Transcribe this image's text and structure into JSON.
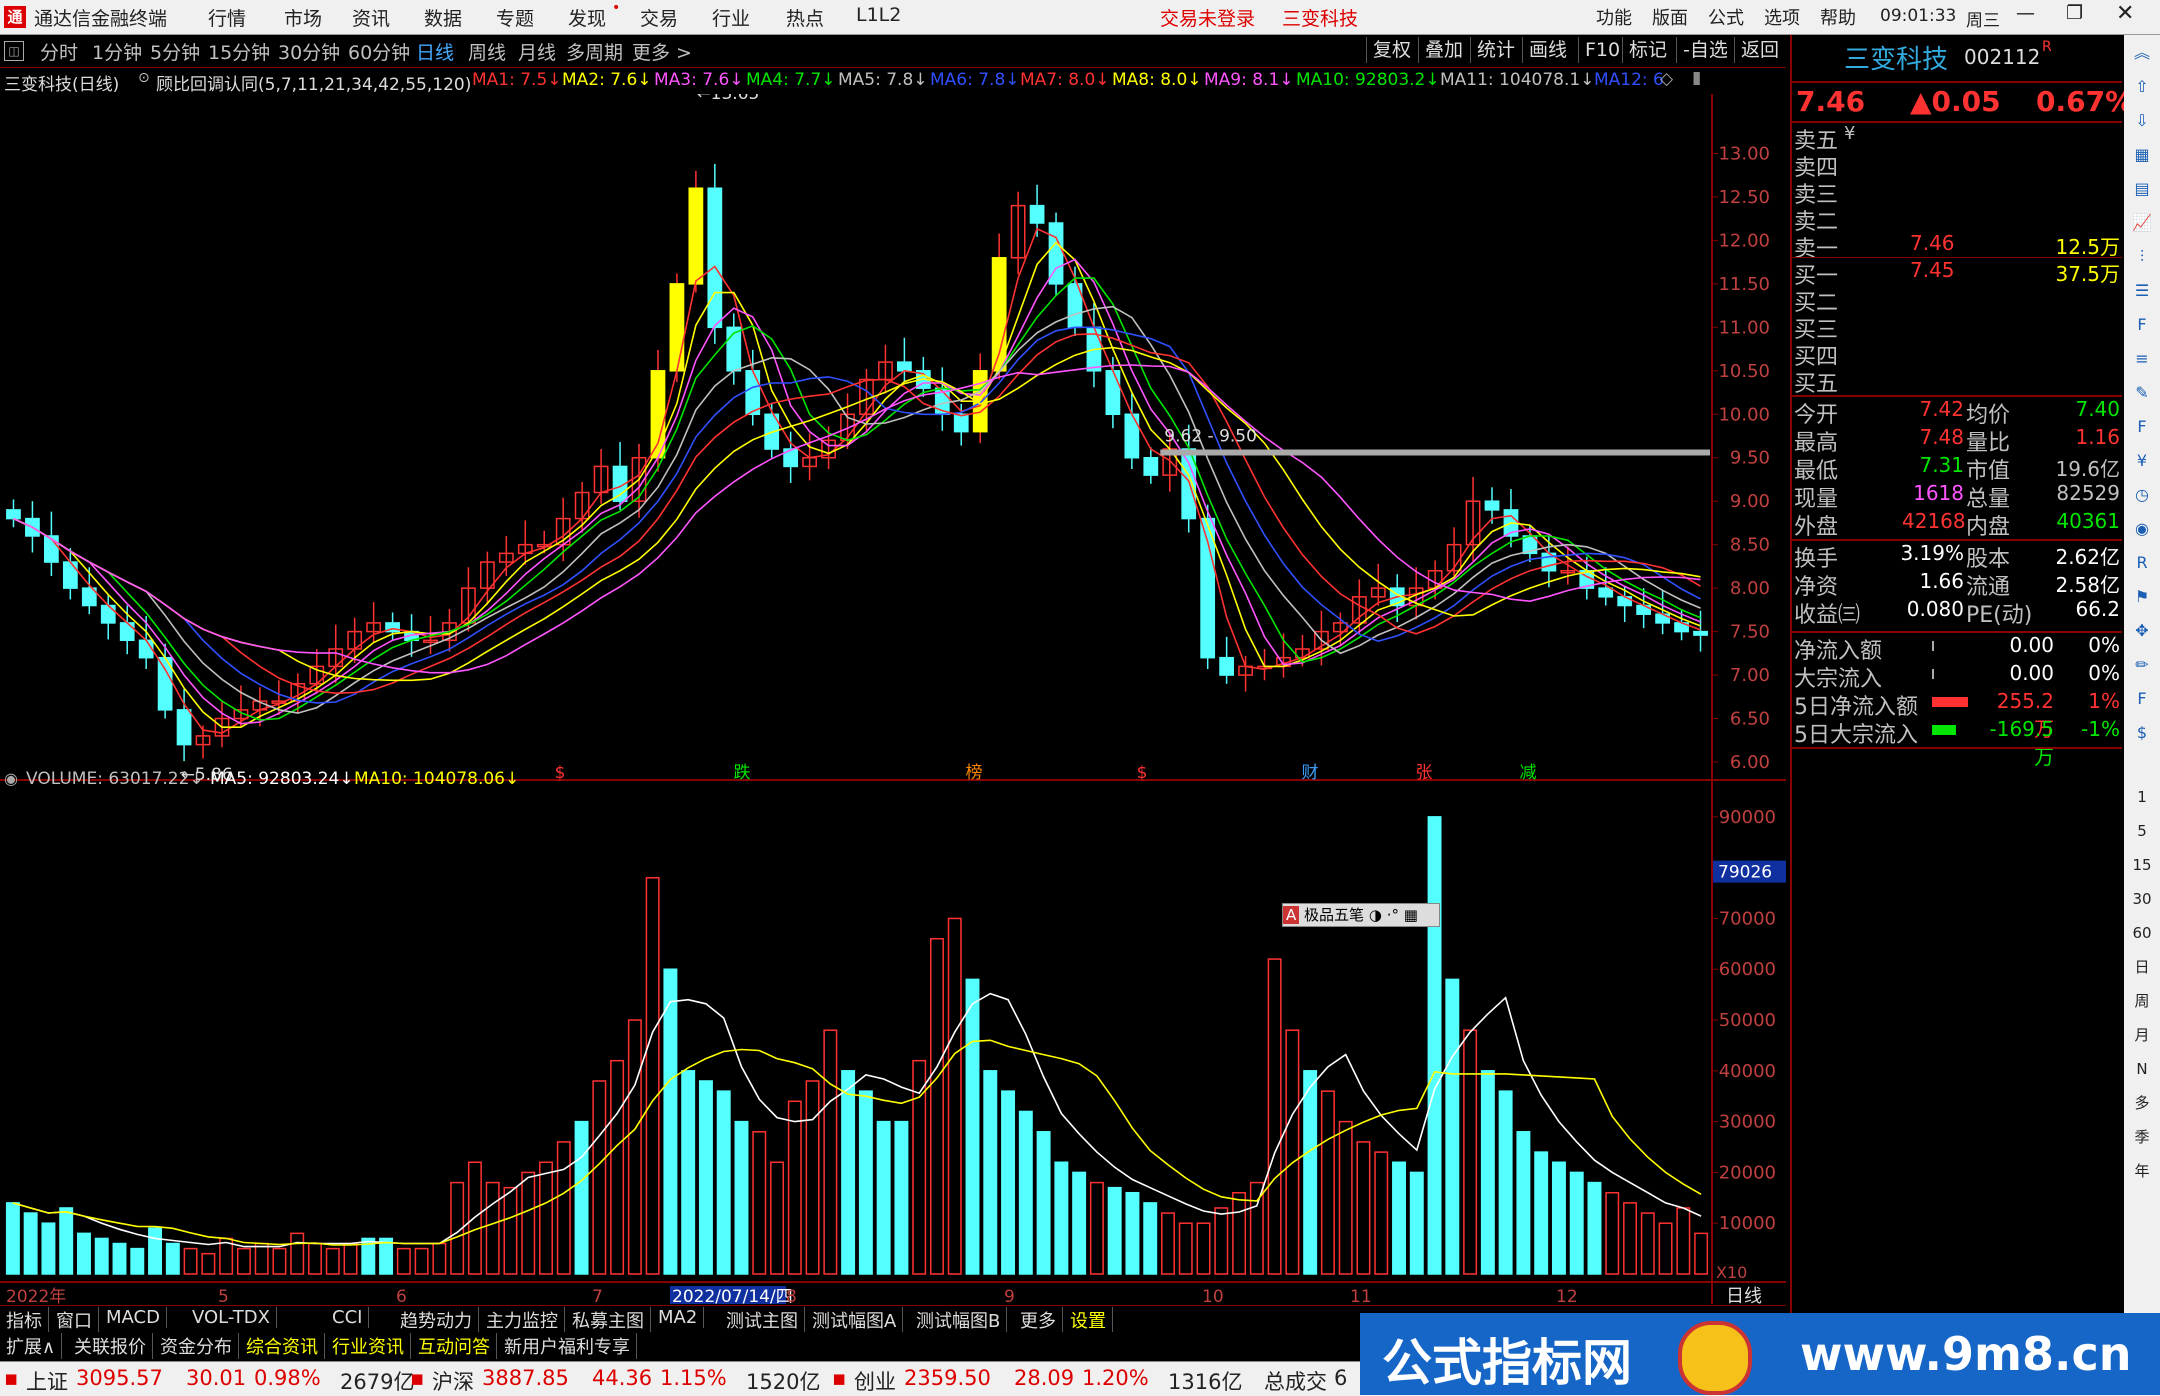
{
  "menubar": {
    "app_title": "通达信金融终端",
    "items": [
      "行情",
      "市场",
      "资讯",
      "数据",
      "专题",
      "发现",
      "交易",
      "行业",
      "热点",
      "L1L2"
    ],
    "status_left": "交易未登录",
    "status_right": "三变科技",
    "right_items": [
      "功能",
      "版面",
      "公式",
      "选项",
      "帮助"
    ],
    "clock": "09:01:33",
    "weekday": "周三"
  },
  "periods": {
    "items": [
      "分时",
      "1分钟",
      "5分钟",
      "15分钟",
      "30分钟",
      "60分钟",
      "日线",
      "周线",
      "月线",
      "多周期",
      "更多 >"
    ],
    "active": "日线",
    "right_buttons": [
      "复权",
      "叠加",
      "统计",
      "画线",
      "F10",
      "标记",
      "-自选",
      "返回"
    ]
  },
  "indicator_header": {
    "stock": "三变科技(日线)",
    "formula": "顾比回调认同(5,7,11,21,34,42,55,120)",
    "mas": [
      {
        "label": "MA1: 7.5↓",
        "color": "#ff3232"
      },
      {
        "label": "MA2: 7.6↓",
        "color": "#ffff00"
      },
      {
        "label": "MA3: 7.6↓",
        "color": "#ff55ff"
      },
      {
        "label": "MA4: 7.7↓",
        "color": "#00e600"
      },
      {
        "label": "MA5: 7.8↓",
        "color": "#c0c0c0"
      },
      {
        "label": "MA6: 7.8↓",
        "color": "#3050ff"
      },
      {
        "label": "MA7: 8.0↓",
        "color": "#ff3232"
      },
      {
        "label": "MA8: 8.0↓",
        "color": "#ffff00"
      },
      {
        "label": "MA9: 8.1↓",
        "color": "#ff55ff"
      },
      {
        "label": "MA10: 92803.2↓",
        "color": "#00e600"
      },
      {
        "label": "MA11: 104078.1↓",
        "color": "#c0c0c0"
      },
      {
        "label": "MA12: 6",
        "color": "#3050ff"
      }
    ]
  },
  "chart_data": [
    {
      "type": "candlestick",
      "title": "三变科技(日线)",
      "y_ticks": [
        "13.00",
        "12.50",
        "12.00",
        "11.50",
        "11.00",
        "10.50",
        "10.00",
        "9.50",
        "9.00",
        "8.50",
        "8.00",
        "7.50",
        "7.00",
        "6.50",
        "6.00"
      ],
      "ylim": [
        6.0,
        13.5
      ],
      "annotations": [
        "13.65",
        "5.86",
        "9.62 - 9.50"
      ],
      "events": [
        "$",
        "跌",
        "榜",
        "$",
        "财",
        "张",
        "减"
      ],
      "close_series_approx": [
        8.8,
        8.6,
        8.3,
        8.0,
        7.8,
        7.6,
        7.4,
        7.2,
        6.6,
        6.2,
        6.3,
        6.5,
        6.6,
        6.7,
        6.7,
        6.9,
        7.1,
        7.3,
        7.5,
        7.6,
        7.5,
        7.4,
        7.4,
        7.6,
        8.0,
        8.3,
        8.4,
        8.5,
        8.5,
        8.8,
        9.1,
        9.4,
        9.0,
        9.5,
        10.5,
        11.5,
        12.6,
        11.0,
        10.5,
        10.0,
        9.6,
        9.4,
        9.5,
        9.7,
        10.0,
        10.4,
        10.6,
        10.5,
        10.3,
        10.0,
        9.8,
        10.5,
        11.8,
        12.4,
        12.2,
        11.5,
        11.0,
        10.5,
        10.0,
        9.5,
        9.3,
        9.6,
        8.8,
        7.2,
        7.0,
        7.1,
        7.1,
        7.2,
        7.3,
        7.5,
        7.6,
        7.9,
        8.0,
        7.8,
        8.0,
        8.2,
        8.5,
        9.0,
        8.9,
        8.6,
        8.4,
        8.2,
        8.2,
        8.0,
        7.9,
        7.8,
        7.7,
        7.6,
        7.5,
        7.46
      ]
    },
    {
      "type": "bar",
      "title": "VOLUME",
      "series_labels": [
        {
          "label": "VOLUME: 63017.22↓",
          "color": "#c0c0c0"
        },
        {
          "label": "MA5: 92803.24↓",
          "color": "#ffffff"
        },
        {
          "label": "MA10: 104078.06↓",
          "color": "#ffff00"
        }
      ],
      "y_ticks": [
        "90000",
        "80000",
        "70000",
        "60000",
        "50000",
        "40000",
        "30000",
        "20000",
        "10000"
      ],
      "ylim": [
        0,
        90000
      ],
      "current_marker": "79026",
      "multiplier_label": "X10",
      "values_approx": [
        14,
        12,
        10,
        13,
        8,
        7,
        6,
        5,
        9,
        6,
        5,
        4,
        7,
        5,
        6,
        5,
        8,
        6,
        5,
        6,
        7,
        7,
        5,
        5,
        6,
        18,
        22,
        18,
        17,
        20,
        22,
        26,
        30,
        38,
        42,
        50,
        78,
        60,
        40,
        38,
        36,
        30,
        28,
        22,
        34,
        38,
        48,
        40,
        36,
        30,
        30,
        42,
        66,
        70,
        58,
        40,
        36,
        32,
        28,
        22,
        20,
        18,
        17,
        16,
        14,
        12,
        10,
        10,
        13,
        16,
        18,
        62,
        48,
        40,
        36,
        30,
        26,
        24,
        22,
        20,
        90,
        58,
        48,
        40,
        36,
        28,
        24,
        22,
        20,
        18,
        16,
        14,
        12,
        10,
        13,
        8
      ]
    }
  ],
  "x_axis": {
    "labels": [
      "2022年",
      "5",
      "6",
      "7",
      "2022/07/14/四",
      "8",
      "9",
      "10",
      "11",
      "12"
    ],
    "period_label": "日线"
  },
  "quote_panel": {
    "stock_name": "三变科技",
    "stock_code": "002112",
    "badge": "R",
    "price": "7.46",
    "change": "▲0.05",
    "change_pct": "0.67%",
    "order_book": [
      {
        "label": "卖五",
        "price": "",
        "vol": "",
        "suffix": "¥"
      },
      {
        "label": "卖四",
        "price": "",
        "vol": ""
      },
      {
        "label": "卖三",
        "price": "",
        "vol": ""
      },
      {
        "label": "卖二",
        "price": "",
        "vol": ""
      },
      {
        "label": "卖一",
        "price": "7.46",
        "vol": "12.5万"
      },
      {
        "label": "买一",
        "price": "7.45",
        "vol": "37.5万"
      },
      {
        "label": "买二",
        "price": "",
        "vol": ""
      },
      {
        "label": "买三",
        "price": "",
        "vol": ""
      },
      {
        "label": "买四",
        "price": "",
        "vol": ""
      },
      {
        "label": "买五",
        "price": "",
        "vol": ""
      }
    ],
    "stats": [
      {
        "l1": "今开",
        "v1": "7.42",
        "c1": "red",
        "l2": "均价",
        "v2": "7.40",
        "c2": "grn"
      },
      {
        "l1": "最高",
        "v1": "7.48",
        "c1": "red",
        "l2": "量比",
        "v2": "1.16",
        "c2": "red"
      },
      {
        "l1": "最低",
        "v1": "7.31",
        "c1": "grn",
        "l2": "市值",
        "v2": "19.6亿",
        "c2": "lbl"
      },
      {
        "l1": "现量",
        "v1": "1618",
        "c1": "mag",
        "l2": "总量",
        "v2": "82529",
        "c2": "lbl"
      },
      {
        "l1": "外盘",
        "v1": "42168",
        "c1": "red",
        "l2": "内盘",
        "v2": "40361",
        "c2": "grn"
      }
    ],
    "stats2": [
      {
        "l1": "换手",
        "v1": "3.19%",
        "l2": "股本",
        "v2": "2.62亿"
      },
      {
        "l1": "净资",
        "v1": "1.66",
        "l2": "流通",
        "v2": "2.58亿"
      },
      {
        "l1": "收益㈢",
        "v1": "0.080",
        "l2": "PE(动)",
        "v2": "66.2"
      }
    ],
    "flows": [
      {
        "label": "净流入额",
        "val": "0.00",
        "pct": "0%",
        "color": "wht",
        "bar": "none"
      },
      {
        "label": "大宗流入",
        "val": "0.00",
        "pct": "0%",
        "color": "wht",
        "bar": "none"
      },
      {
        "label": "5日净流入额",
        "val": "255.2万",
        "pct": "1%",
        "color": "red",
        "bar": "red"
      },
      {
        "label": "5日大宗流入",
        "val": "-169.5万",
        "pct": "-1%",
        "color": "grn",
        "bar": "grn"
      }
    ]
  },
  "right_toolbar": {
    "icons": [
      "chevron-up",
      "arrow-up",
      "arrow-down",
      "grid",
      "table",
      "chart",
      "kline",
      "list",
      "f10",
      "list2",
      "note",
      "f-icon",
      "fund",
      "clock",
      "eye",
      "rsi",
      "flag",
      "move",
      "pen",
      "fs",
      "dollar"
    ],
    "periods": [
      "1",
      "5",
      "15",
      "30",
      "60",
      "日",
      "周",
      "月",
      "N",
      "多",
      "季",
      "年"
    ]
  },
  "tabs_row1": [
    "指标",
    "窗口",
    "MACD",
    "VOL-TDX",
    "CCI",
    "趋势动力",
    "主力监控",
    "私募主图",
    "MA2",
    "测试主图",
    "测试幅图A",
    "测试幅图B",
    "更多",
    "设置"
  ],
  "tabs_row2": [
    "扩展∧",
    "关联报价",
    "资金分布",
    "综合资讯",
    "行业资讯",
    "互动问答",
    "新用户福利专享"
  ],
  "statusbar": {
    "items": [
      {
        "name": "上证",
        "val": "3095.57",
        "chg": "30.01",
        "pct": "0.98%",
        "amt": "2679亿"
      },
      {
        "name": "沪深",
        "val": "3887.85",
        "chg": "44.36",
        "pct": "1.15%",
        "amt": "1520亿"
      },
      {
        "name": "创业",
        "val": "2359.50",
        "chg": "28.09",
        "pct": "1.20%",
        "amt": "1316亿"
      }
    ],
    "total_label": "总成交",
    "total_val": "6"
  },
  "drawing_toolbar": {
    "label": "极品五笔"
  },
  "banner": {
    "title": "公式指标网",
    "url": "www.9m8.cn"
  }
}
